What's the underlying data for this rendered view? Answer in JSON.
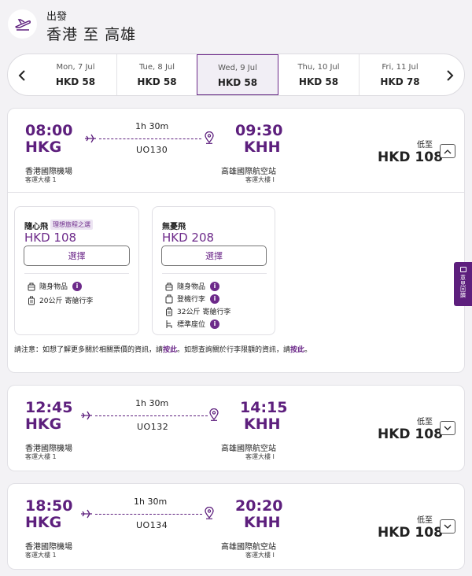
{
  "header": {
    "subtitle": "出發",
    "route": "香港 至 高雄"
  },
  "dates": [
    {
      "day": "Mon, 7 Jul",
      "price": "HKD 58",
      "selected": false
    },
    {
      "day": "Tue, 8 Jul",
      "price": "HKD 58",
      "selected": false
    },
    {
      "day": "Wed, 9 Jul",
      "price": "HKD 58",
      "selected": true
    },
    {
      "day": "Thu, 10 Jul",
      "price": "HKD 58",
      "selected": false
    },
    {
      "day": "Fri, 11 Jul",
      "price": "HKD 78",
      "selected": false
    }
  ],
  "flights": [
    {
      "dep_time": "08:00",
      "dep_code": "HKG",
      "arr_time": "09:30",
      "arr_code": "KHH",
      "duration": "1h 30m",
      "flight_no": "UO130",
      "dep_airport": "香港國際機場",
      "dep_terminal": "客運大樓 1",
      "arr_airport": "高雄國際航空站",
      "arr_terminal": "客運大樓 I",
      "from_label": "低至",
      "price": "HKD 108",
      "expanded": true
    },
    {
      "dep_time": "12:45",
      "dep_code": "HKG",
      "arr_time": "14:15",
      "arr_code": "KHH",
      "duration": "1h 30m",
      "flight_no": "UO132",
      "dep_airport": "香港國際機場",
      "dep_terminal": "客運大樓 1",
      "arr_airport": "高雄國際航空站",
      "arr_terminal": "客運大樓 I",
      "from_label": "低至",
      "price": "HKD 108",
      "expanded": false
    },
    {
      "dep_time": "18:50",
      "dep_code": "HKG",
      "arr_time": "20:20",
      "arr_code": "KHH",
      "duration": "1h 30m",
      "flight_no": "UO134",
      "dep_airport": "香港國際機場",
      "dep_terminal": "客運大樓 1",
      "arr_airport": "高雄國際航空站",
      "arr_terminal": "客運大樓 I",
      "from_label": "低至",
      "price": "HKD 108",
      "expanded": false
    }
  ],
  "fares": [
    {
      "name": "隨心飛",
      "tag": "理想旅程之選",
      "price": "HKD 108",
      "button": "選擇",
      "features": [
        {
          "icon": "carry-on-bag-icon",
          "text": "隨身物品",
          "info": true
        },
        {
          "icon": "checked-bag-icon",
          "text": "20公斤 寄艙行李",
          "info": false
        }
      ]
    },
    {
      "name": "無憂飛",
      "tag": "",
      "price": "HKD 208",
      "button": "選擇",
      "features": [
        {
          "icon": "carry-on-bag-icon",
          "text": "隨身物品",
          "info": true
        },
        {
          "icon": "cabin-bag-icon",
          "text": "登機行李",
          "info": true
        },
        {
          "icon": "checked-bag-icon",
          "text": "32公斤 寄艙行李",
          "info": false
        },
        {
          "icon": "seat-icon",
          "text": "標準座位",
          "info": true
        }
      ]
    }
  ],
  "note": {
    "part1": "請注意：如想了解更多關於相關票價的資訊，請",
    "link1": "按此",
    "part2": "。如想查詢關於行李限額的資訊，請",
    "link2": "按此",
    "part3": "。"
  },
  "feedback": {
    "label": "意見回饋"
  },
  "colors": {
    "brand": "#5d1f7d",
    "accent": "#6d2a8a",
    "background": "#f3f2f5"
  }
}
